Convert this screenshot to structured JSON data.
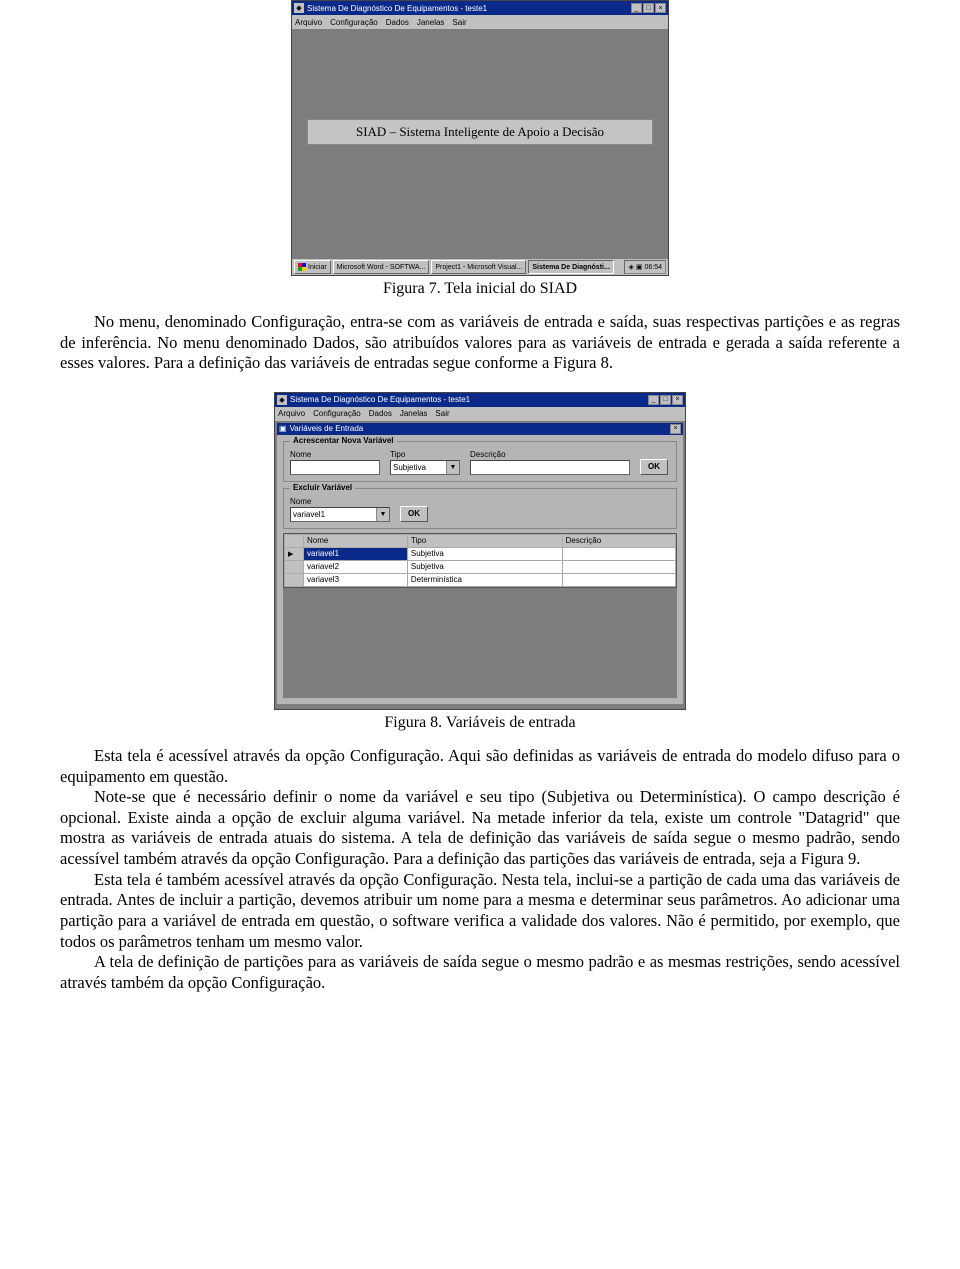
{
  "shot1": {
    "window_title": "Sistema De Diagnóstico De Equipamentos - teste1",
    "menu": [
      "Arquivo",
      "Configuração",
      "Dados",
      "Janelas",
      "Sair"
    ],
    "banner": "SIAD – Sistema Inteligente de Apoio a Decisão",
    "taskbar": {
      "start": "Iniciar",
      "items": [
        "Microsoft Word - SOFTWA...",
        "Project1 - Microsoft Visual...",
        "Sistema De Diagnósti..."
      ],
      "clock": "06:54"
    }
  },
  "caption1": "Figura 7. Tela inicial do SIAD",
  "para1": "No menu, denominado Configuração, entra-se com as variáveis de entrada e saída, suas respectivas partições e as regras de inferência. No menu denominado Dados, são atribuídos valores para as variáveis de entrada e gerada a saída referente a esses valores. Para a definição das variáveis de entradas segue conforme a Figura 8.",
  "shot2": {
    "window_title": "Sistema De Diagnóstico De Equipamentos - teste1",
    "menu": [
      "Arquivo",
      "Configuração",
      "Dados",
      "Janelas",
      "Sair"
    ],
    "inner_title": "Variáveis de Entrada",
    "group_add": {
      "legend": "Acrescentar Nova Variável",
      "labels": {
        "nome": "Nome",
        "tipo": "Tipo",
        "descricao": "Descrição"
      },
      "tipo_value": "Subjetiva",
      "ok": "OK"
    },
    "group_del": {
      "legend": "Excluir Variável",
      "labels": {
        "nome": "Nome"
      },
      "nome_value": "variavel1",
      "ok": "OK"
    },
    "grid": {
      "headers": [
        "Nome",
        "Tipo",
        "Descrição"
      ],
      "rows": [
        {
          "nome": "variavel1",
          "tipo": "Subjetiva",
          "desc": "",
          "selected": true
        },
        {
          "nome": "variavel2",
          "tipo": "Subjetiva",
          "desc": "",
          "selected": false
        },
        {
          "nome": "variavel3",
          "tipo": "Determinística",
          "desc": "",
          "selected": false
        }
      ]
    }
  },
  "caption2": "Figura 8. Variáveis de entrada",
  "para2a": "Esta tela é acessível através da opção Configuração. Aqui são definidas as variáveis de entrada do modelo difuso para o equipamento em questão.",
  "para2b": "Note-se que é necessário definir o nome da variável e seu tipo (Subjetiva ou Determinística). O campo descrição é opcional. Existe ainda a opção de excluir alguma variável.  Na metade inferior da tela, existe um controle \"Datagrid\" que mostra as variáveis de entrada atuais do sistema. A tela de definição das variáveis de saída segue o mesmo padrão, sendo acessível também através da opção Configuração. Para a definição das partições das variáveis de entrada, seja a Figura 9.",
  "para2c": "Esta tela é também acessível através da opção Configuração. Nesta tela, inclui-se a partição de cada uma das variáveis de entrada. Antes de incluir a partição, devemos atribuir um nome para a mesma e determinar seus parâmetros. Ao adicionar uma partição para a variável de entrada em questão, o software verifica a validade dos valores.  Não é permitido, por exemplo, que todos os parâmetros tenham um mesmo valor.",
  "para2d": "A tela de definição de partições para as variáveis de saída segue o mesmo padrão e as mesmas restrições, sendo acessível através também da opção Configuração."
}
